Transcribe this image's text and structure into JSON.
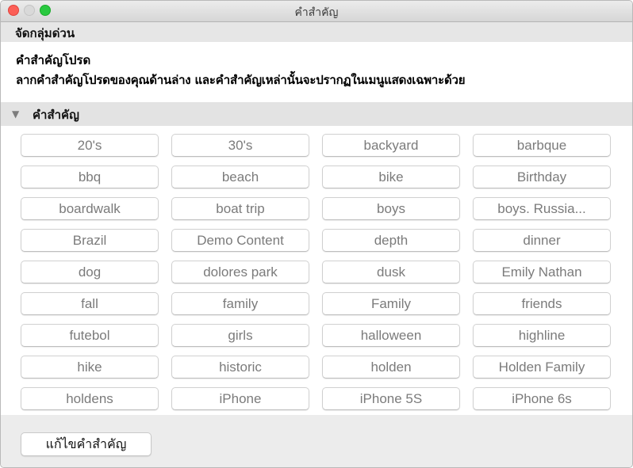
{
  "window": {
    "title": "คำสำคัญ",
    "controls": [
      "close",
      "minimize",
      "zoom"
    ]
  },
  "quick_group": {
    "label": "จัดกลุ่มด่วน"
  },
  "favorites": {
    "title": "คำสำคัญโปรด",
    "description": "ลากคำสำคัญโปรดของคุณด้านล่าง และคำสำคัญเหล่านั้นจะปรากฏในเมนูแสดงเฉพาะด้วย"
  },
  "keywords_section": {
    "label": "คำสำคัญ",
    "expanded": true,
    "items": [
      "20's",
      "30's",
      "backyard",
      "barbque",
      "bbq",
      "beach",
      "bike",
      "Birthday",
      "boardwalk",
      "boat trip",
      "boys",
      "boys. Russia...",
      "Brazil",
      "Demo Content",
      "depth",
      "dinner",
      "dog",
      "dolores park",
      "dusk",
      "Emily Nathan",
      "fall",
      "family",
      "Family",
      "friends",
      "futebol",
      "girls",
      "halloween",
      "highline",
      "hike",
      "historic",
      "holden",
      "Holden Family",
      "holdens",
      "iPhone",
      "iPhone 5S",
      "iPhone 6s"
    ]
  },
  "footer": {
    "edit_button": "แก้ไขคำสำคัญ"
  }
}
